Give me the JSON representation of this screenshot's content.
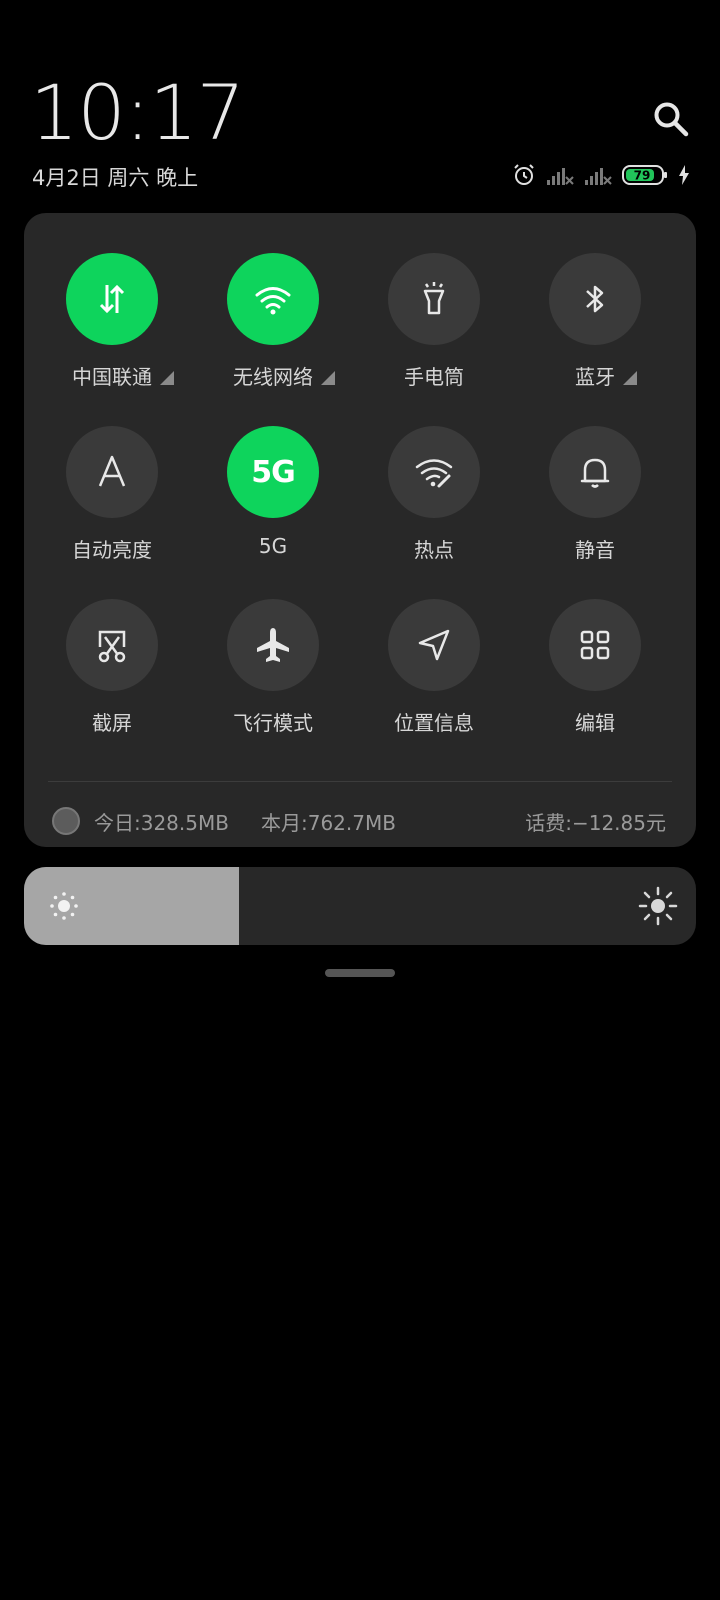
{
  "header": {
    "time": "10:17",
    "date": "4月2日 周六 晚上",
    "battery": "79"
  },
  "tiles": [
    {
      "label": "中国联通",
      "on": true,
      "expand": true
    },
    {
      "label": "无线网络",
      "on": true,
      "expand": true
    },
    {
      "label": "手电筒",
      "on": false,
      "expand": false
    },
    {
      "label": "蓝牙",
      "on": false,
      "expand": true
    },
    {
      "label": "自动亮度",
      "on": false,
      "expand": false
    },
    {
      "label": "5G",
      "on": true,
      "expand": false,
      "icon_text": "5G"
    },
    {
      "label": "热点",
      "on": false,
      "expand": false
    },
    {
      "label": "静音",
      "on": false,
      "expand": false
    },
    {
      "label": "截屏",
      "on": false,
      "expand": false
    },
    {
      "label": "飞行模式",
      "on": false,
      "expand": false
    },
    {
      "label": "位置信息",
      "on": false,
      "expand": false
    },
    {
      "label": "编辑",
      "on": false,
      "expand": false
    }
  ],
  "usage": {
    "today": "今日:328.5MB",
    "month": "本月:762.7MB",
    "fee": "话费:−12.85元"
  },
  "brightness": {
    "level": 0.32
  },
  "colors": {
    "accent": "#0ed45c",
    "tile_off": "#3a3a3a",
    "panel": "#282828"
  }
}
